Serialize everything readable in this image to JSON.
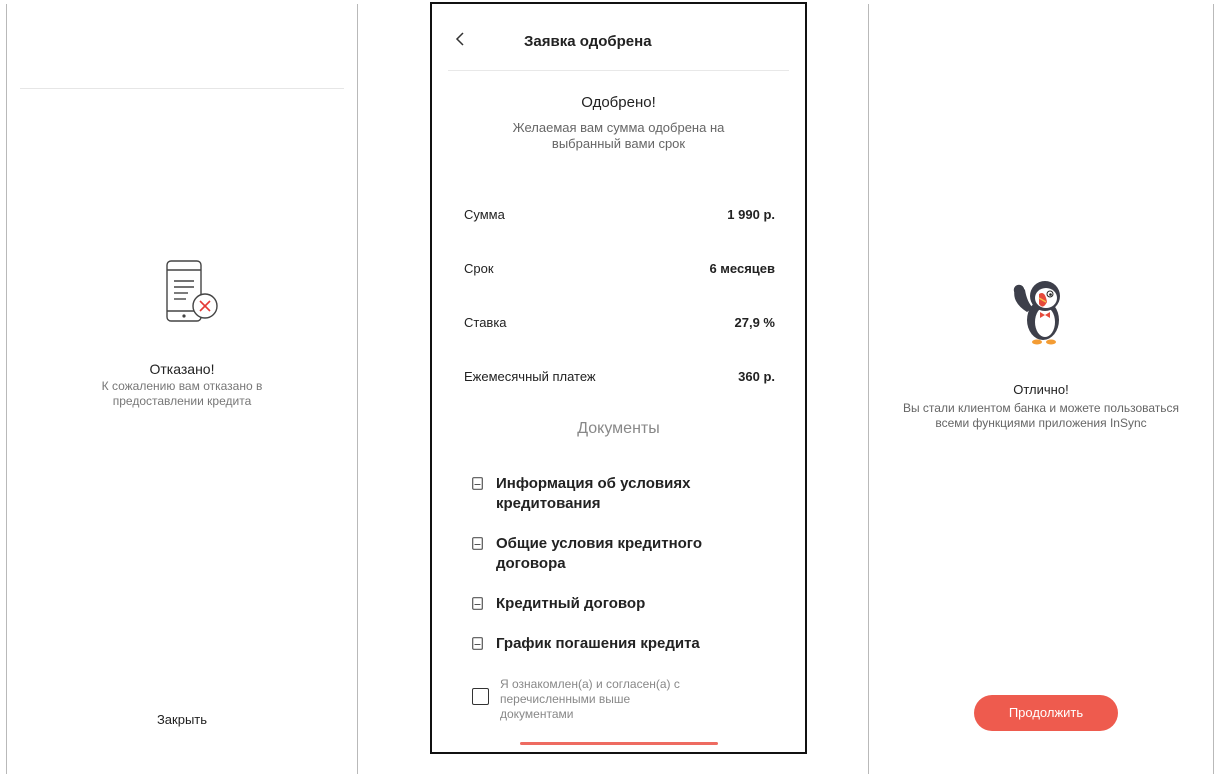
{
  "rejected": {
    "icon": "phone-document-rejected-icon",
    "title": "Отказано!",
    "text": "К сожалению вам отказано в предоставлении кредита",
    "close_label": "Закрыть"
  },
  "approved": {
    "header_title": "Заявка одобрена",
    "back_icon": "chevron-left-icon",
    "title": "Одобрено!",
    "text": "Желаемая вам сумма одобрена на выбранный вами срок",
    "details": [
      {
        "label": "Сумма",
        "value": "1 990 р."
      },
      {
        "label": "Срок",
        "value": "6 месяцев"
      },
      {
        "label": "Ставка",
        "value": "27,9 %"
      },
      {
        "label": "Ежемесячный платеж",
        "value": "360 р."
      }
    ],
    "documents_title": "Документы",
    "documents": [
      "Информация об условиях кредитования",
      "Общие условия кредитного договора",
      "Кредитный договор",
      "График погашения кредита"
    ],
    "agreement_text": "Я ознакомлен(а) и согласен(а) с перечисленными выше документами",
    "agreement_checked": false
  },
  "success": {
    "mascot": "puffin-mascot-ok-gesture",
    "title": "Отлично!",
    "text": "Вы стали клиентом банка и можете пользоваться всеми функциями приложения InSync",
    "continue_label": "Продолжить"
  },
  "colors": {
    "accent": "#ee5b4e",
    "text_primary": "#222222",
    "text_secondary": "#777777",
    "divider": "#e6e6e6"
  }
}
